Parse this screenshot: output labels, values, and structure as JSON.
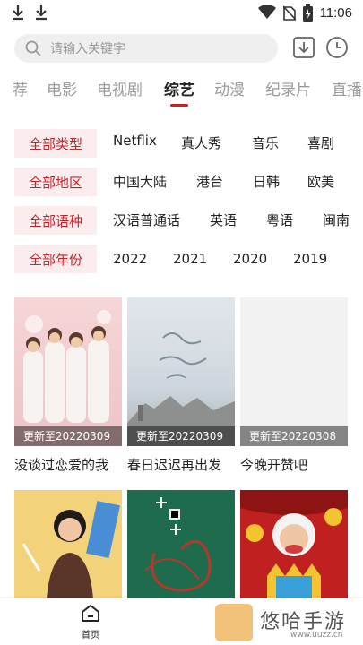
{
  "status_bar": {
    "time": "11:06"
  },
  "search": {
    "placeholder": "请输入关键字"
  },
  "tabs": [
    {
      "label": "荐"
    },
    {
      "label": "电影"
    },
    {
      "label": "电视剧"
    },
    {
      "label": "综艺"
    },
    {
      "label": "动漫"
    },
    {
      "label": "纪录片"
    },
    {
      "label": "直播"
    }
  ],
  "active_tab": "综艺",
  "filters": [
    {
      "chip": "全部类型",
      "options": [
        "Netflix",
        "真人秀",
        "音乐",
        "喜剧"
      ]
    },
    {
      "chip": "全部地区",
      "options": [
        "中国大陆",
        "港台",
        "日韩",
        "欧美"
      ]
    },
    {
      "chip": "全部语种",
      "options": [
        "汉语普通话",
        "英语",
        "粤语",
        "闽南"
      ]
    },
    {
      "chip": "全部年份",
      "options": [
        "2022",
        "2021",
        "2020",
        "2019"
      ]
    }
  ],
  "cards": [
    {
      "title": "没谈过恋爱的我",
      "badge": "更新至20220309"
    },
    {
      "title": "春日迟迟再出发",
      "badge": "更新至20220309"
    },
    {
      "title": "今晚开赞吧",
      "badge": "更新至20220308"
    }
  ],
  "bottom_nav": {
    "home": "首页"
  },
  "watermark": {
    "text": "悠哈手游",
    "url": "www.uuzz.cn"
  },
  "colors": {
    "accent": "#c0242d",
    "chip_bg": "#fbecee"
  }
}
